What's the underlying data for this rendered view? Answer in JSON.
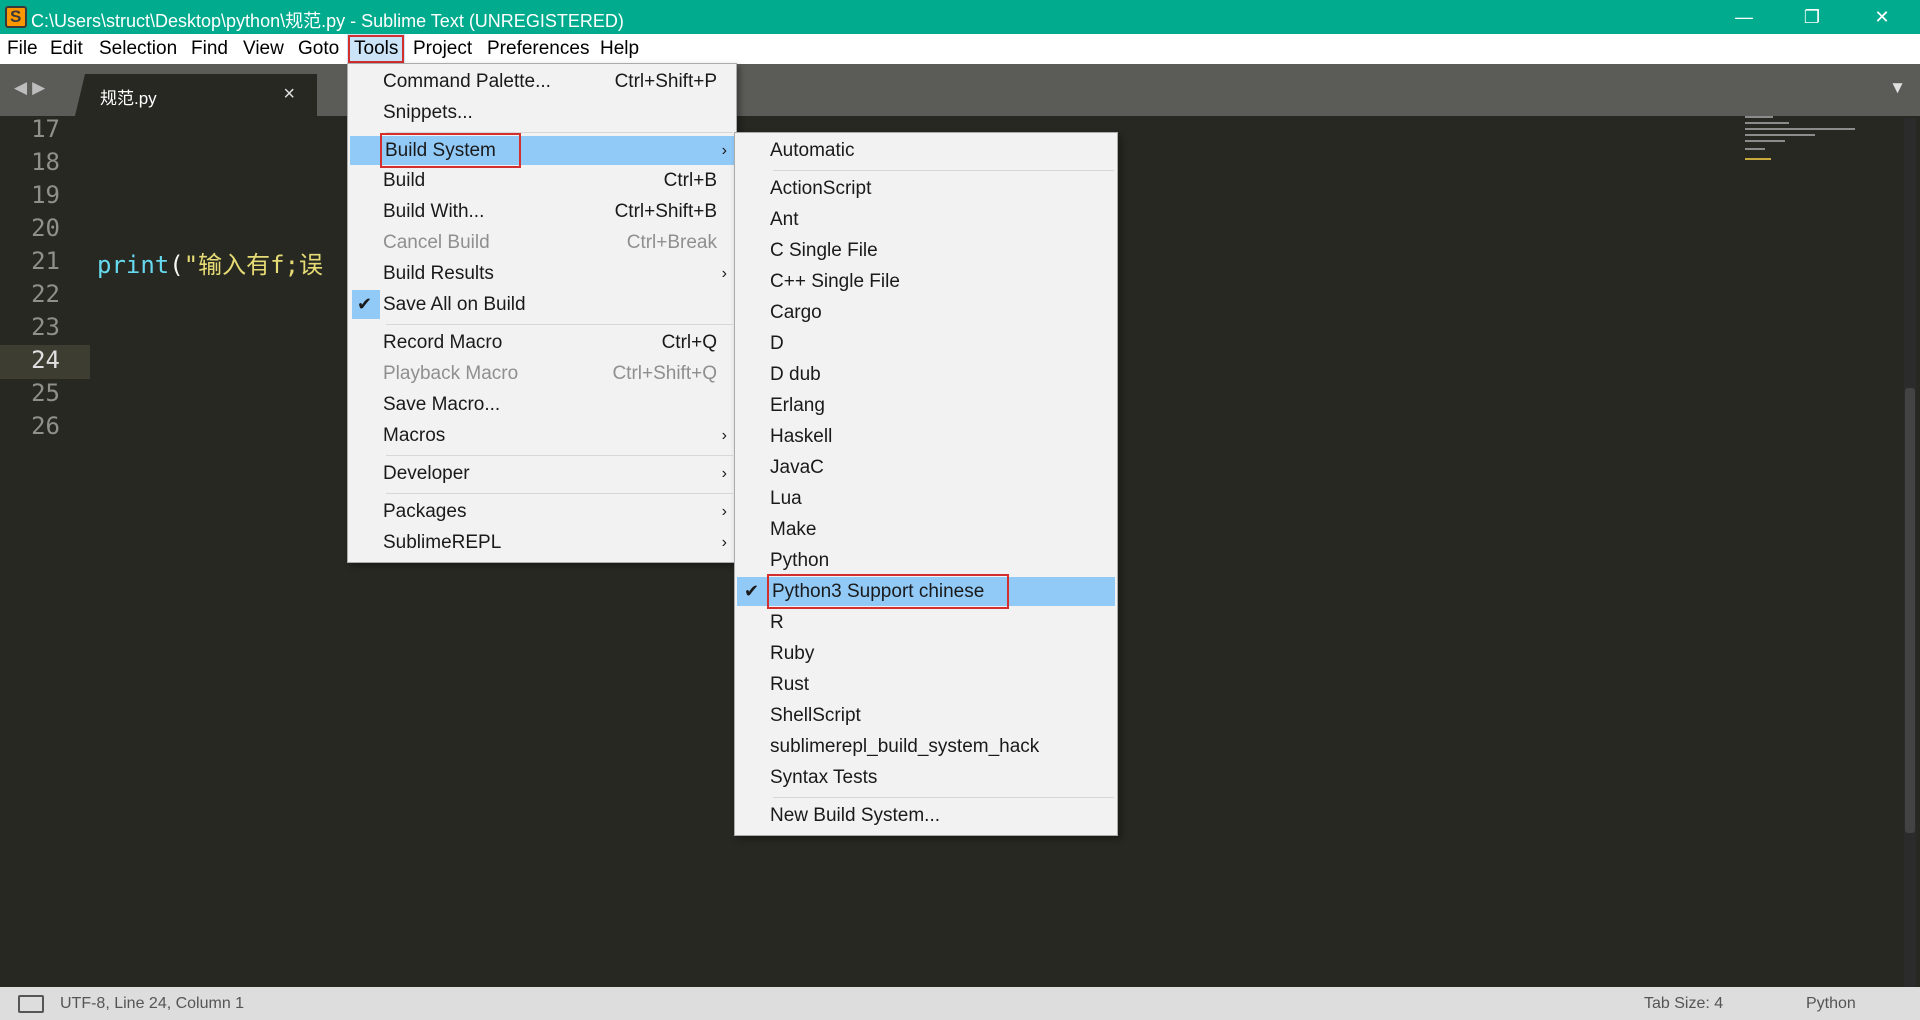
{
  "window": {
    "title": "C:\\Users\\struct\\Desktop\\python\\规范.py - Sublime Text (UNREGISTERED)",
    "controls": [
      "—",
      "❐",
      "✕"
    ]
  },
  "menubar": {
    "items": [
      "File",
      "Edit",
      "Selection",
      "Find",
      "View",
      "Goto",
      "Tools",
      "Project",
      "Preferences",
      "Help"
    ],
    "open_item": "Tools"
  },
  "tabs": {
    "active": "规范.py",
    "close_glyph": "×"
  },
  "editor": {
    "line_numbers": [
      "17",
      "18",
      "19",
      "20",
      "21",
      "22",
      "23",
      "24",
      "25",
      "26"
    ],
    "current_line": "24",
    "code_line_21": {
      "fn": "print",
      "paren": "(",
      "str": "\"输入有f;误"
    }
  },
  "tools_menu": {
    "items": [
      {
        "label": "Command Palette...",
        "shortcut": "Ctrl+Shift+P"
      },
      {
        "label": "Snippets...",
        "shortcut": ""
      },
      {
        "label": "Build System",
        "shortcut": "",
        "submenu": true,
        "highlighted": true
      },
      {
        "label": "Build",
        "shortcut": "Ctrl+B"
      },
      {
        "label": "Build With...",
        "shortcut": "Ctrl+Shift+B"
      },
      {
        "label": "Cancel Build",
        "shortcut": "Ctrl+Break",
        "disabled": true
      },
      {
        "label": "Build Results",
        "shortcut": "",
        "submenu": true
      },
      {
        "label": "Save All on Build",
        "shortcut": "",
        "checked": true
      },
      {
        "label": "Record Macro",
        "shortcut": "Ctrl+Q"
      },
      {
        "label": "Playback Macro",
        "shortcut": "Ctrl+Shift+Q",
        "disabled": true
      },
      {
        "label": "Save Macro...",
        "shortcut": ""
      },
      {
        "label": "Macros",
        "shortcut": "",
        "submenu": true
      },
      {
        "label": "Developer",
        "shortcut": "",
        "submenu": true
      },
      {
        "label": "Packages",
        "shortcut": "",
        "submenu": true
      },
      {
        "label": "SublimeREPL",
        "shortcut": "",
        "submenu": true
      }
    ]
  },
  "build_system_menu": {
    "items": [
      "Automatic",
      "ActionScript",
      "Ant",
      "C Single File",
      "C++ Single File",
      "Cargo",
      "D",
      "D dub",
      "Erlang",
      "Haskell",
      "JavaC",
      "Lua",
      "Make",
      "Python",
      "Python3  Support chinese",
      "R",
      "Ruby",
      "Rust",
      "ShellScript",
      "sublimerepl_build_system_hack",
      "Syntax Tests",
      "New Build System..."
    ],
    "selected": "Python3  Support chinese"
  },
  "statusbar": {
    "position": "UTF-8, Line 24, Column 1",
    "tab_size": "Tab Size: 4",
    "syntax": "Python"
  },
  "colors": {
    "titlebar": "#00ab8e",
    "editor_bg": "#272822",
    "menu_highlight": "#91c9f7",
    "annotation_box": "#d32f2f"
  }
}
